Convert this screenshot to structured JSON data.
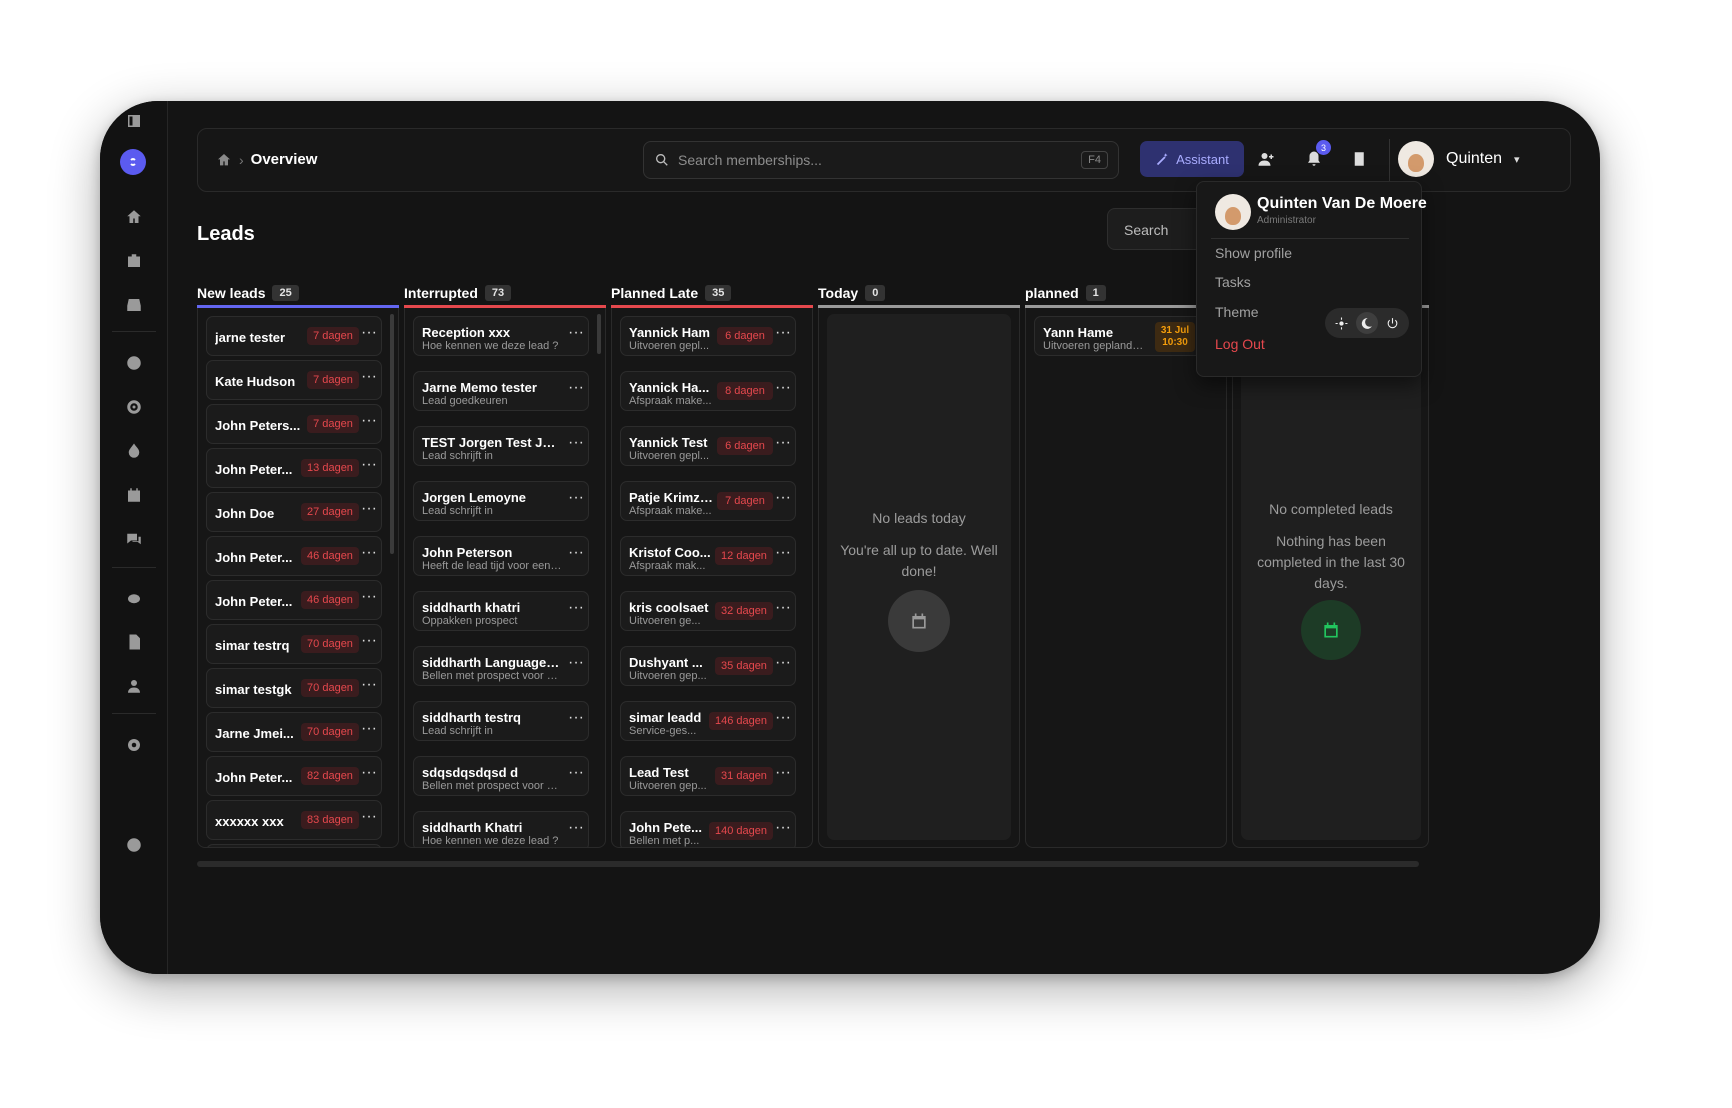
{
  "breadcrumb": {
    "current": "Overview"
  },
  "search": {
    "placeholder": "Search memberships...",
    "shortcut": "F4"
  },
  "assistant": {
    "label": "Assistant"
  },
  "notifications": {
    "count": "3"
  },
  "user": {
    "name": "Quinten",
    "full_name": "Quinten Van De Moere",
    "role": "Administrator"
  },
  "page": {
    "title": "Leads",
    "search_placeholder": "Search"
  },
  "user_menu": {
    "show_profile": "Show profile",
    "tasks": "Tasks",
    "theme": "Theme",
    "logout": "Log Out"
  },
  "columns": [
    {
      "title": "New leads",
      "count": "25",
      "color": "#6366f1",
      "cards": [
        {
          "name": "jarne tester",
          "tag": "7 dagen"
        },
        {
          "name": "Kate Hudson",
          "tag": "7 dagen"
        },
        {
          "name": "John Peters...",
          "tag": "7 dagen"
        },
        {
          "name": "John Peter...",
          "tag": "13 dagen"
        },
        {
          "name": "John Doe",
          "tag": "27 dagen"
        },
        {
          "name": "John Peter...",
          "tag": "46 dagen"
        },
        {
          "name": "John Peter...",
          "tag": "46 dagen"
        },
        {
          "name": "simar testrq",
          "tag": "70 dagen"
        },
        {
          "name": "simar testgk",
          "tag": "70 dagen"
        },
        {
          "name": "Jarne Jmei...",
          "tag": "70 dagen"
        },
        {
          "name": "John Peter...",
          "tag": "82 dagen"
        },
        {
          "name": "xxxxxx xxx",
          "tag": "83 dagen"
        }
      ]
    },
    {
      "title": "Interrupted",
      "count": "73",
      "color": "#e5484d",
      "cards": [
        {
          "name": "Reception xxx",
          "sub": "Hoe kennen we deze lead ?"
        },
        {
          "name": "Jarne Memo tester",
          "sub": "Lead goedkeuren"
        },
        {
          "name": "TEST Jorgen Test Jorg...",
          "sub": "Lead schrijft in"
        },
        {
          "name": "Jorgen Lemoyne",
          "sub": "Lead schrijft in"
        },
        {
          "name": "John Peterson",
          "sub": "Heeft de lead tijd voor een r..."
        },
        {
          "name": "siddharth khatri",
          "sub": "Oppakken prospect"
        },
        {
          "name": "siddharth Language test",
          "sub": "Bellen met prospect voor af..."
        },
        {
          "name": "siddharth testrq",
          "sub": "Lead schrijft in"
        },
        {
          "name": "sdqsdqsdqsd d",
          "sub": "Bellen met prospect voor af..."
        },
        {
          "name": "siddharth Khatri",
          "sub": "Hoe kennen we deze lead ?"
        }
      ]
    },
    {
      "title": "Planned Late",
      "count": "35",
      "color": "#e5484d",
      "cards": [
        {
          "name": "Yannick Ham",
          "sub": "Uitvoeren gepl...",
          "tag": "6 dagen"
        },
        {
          "name": "Yannick Ha...",
          "sub": "Afspraak make...",
          "tag": "8 dagen"
        },
        {
          "name": "Yannick Test",
          "sub": "Uitvoeren gepl...",
          "tag": "6 dagen"
        },
        {
          "name": "Patje Krimzon",
          "sub": "Afspraak make...",
          "tag": "7 dagen"
        },
        {
          "name": "Kristof Coo...",
          "sub": "Afspraak mak...",
          "tag": "12 dagen"
        },
        {
          "name": "kris coolsaet",
          "sub": "Uitvoeren ge...",
          "tag": "32 dagen"
        },
        {
          "name": "Dushyant ...",
          "sub": "Uitvoeren gep...",
          "tag": "35 dagen"
        },
        {
          "name": "simar leadd",
          "sub": "Service-ges...",
          "tag": "146 dagen"
        },
        {
          "name": "Lead Test",
          "sub": "Uitvoeren gep...",
          "tag": "31 dagen"
        },
        {
          "name": "John Pete...",
          "sub": "Bellen met p...",
          "tag": "140 dagen"
        }
      ]
    },
    {
      "title": "Today",
      "count": "0",
      "color": "#9a9a9a",
      "empty_title": "No leads today",
      "empty_text": "You're all up to date. Well done!"
    },
    {
      "title": "planned",
      "count": "1",
      "color": "#9a9a9a",
      "cards": [
        {
          "name": "Yann Hame",
          "sub": "Uitvoeren geplande...",
          "date": "31 Jul",
          "time": "10:30"
        }
      ]
    },
    {
      "title": "",
      "count": "",
      "color": "#9a9a9a",
      "empty_title": "No completed leads",
      "empty_text": "Nothing has been completed in the last 30 days."
    }
  ]
}
